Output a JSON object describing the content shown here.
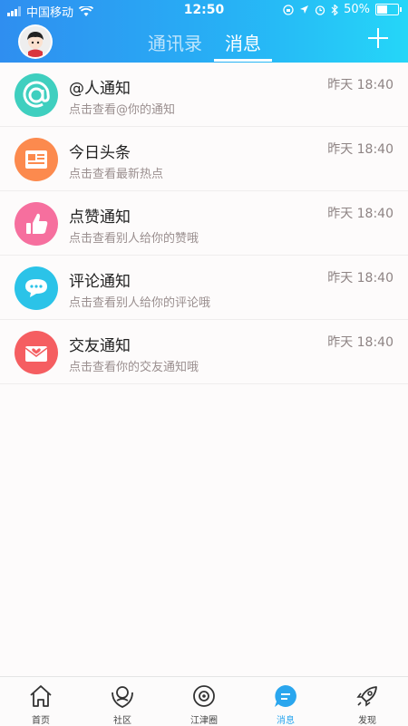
{
  "status_bar": {
    "carrier": "中国移动",
    "time": "12:50",
    "battery": "50%",
    "battery_level": 0.5
  },
  "header": {
    "tabs": [
      {
        "label": "通讯录",
        "active": false
      },
      {
        "label": "消息",
        "active": true
      }
    ],
    "add_icon": "plus-icon",
    "avatar_icon": "user-avatar"
  },
  "messages": [
    {
      "title": "@人通知",
      "desc": "点击查看@你的通知",
      "time": "昨天 18:40",
      "icon": "at-icon",
      "color": "#3fcfbf"
    },
    {
      "title": "今日头条",
      "desc": "点击查看最新热点",
      "time": "昨天 18:40",
      "icon": "newspaper-icon",
      "color": "#fc8a4e"
    },
    {
      "title": "点赞通知",
      "desc": "点击查看别人给你的赞哦",
      "time": "昨天 18:40",
      "icon": "thumbs-up-icon",
      "color": "#f66f9e"
    },
    {
      "title": "评论通知",
      "desc": "点击查看别人给你的评论哦",
      "time": "昨天 18:40",
      "icon": "comment-icon",
      "color": "#2bc3e8"
    },
    {
      "title": "交友通知",
      "desc": "点击查看你的交友通知哦",
      "time": "昨天 18:40",
      "icon": "heart-mail-icon",
      "color": "#f55e61"
    }
  ],
  "tab_bar": [
    {
      "label": "首页",
      "icon": "home-icon",
      "active": false
    },
    {
      "label": "社区",
      "icon": "community-icon",
      "active": false
    },
    {
      "label": "江津圈",
      "icon": "planet-icon",
      "active": false
    },
    {
      "label": "消息",
      "icon": "message-icon",
      "active": true
    },
    {
      "label": "发现",
      "icon": "rocket-icon",
      "active": false
    }
  ],
  "colors": {
    "header_start": "#2f8ef0",
    "header_end": "#25d6f8",
    "active_tab": "#2aa6ee"
  }
}
